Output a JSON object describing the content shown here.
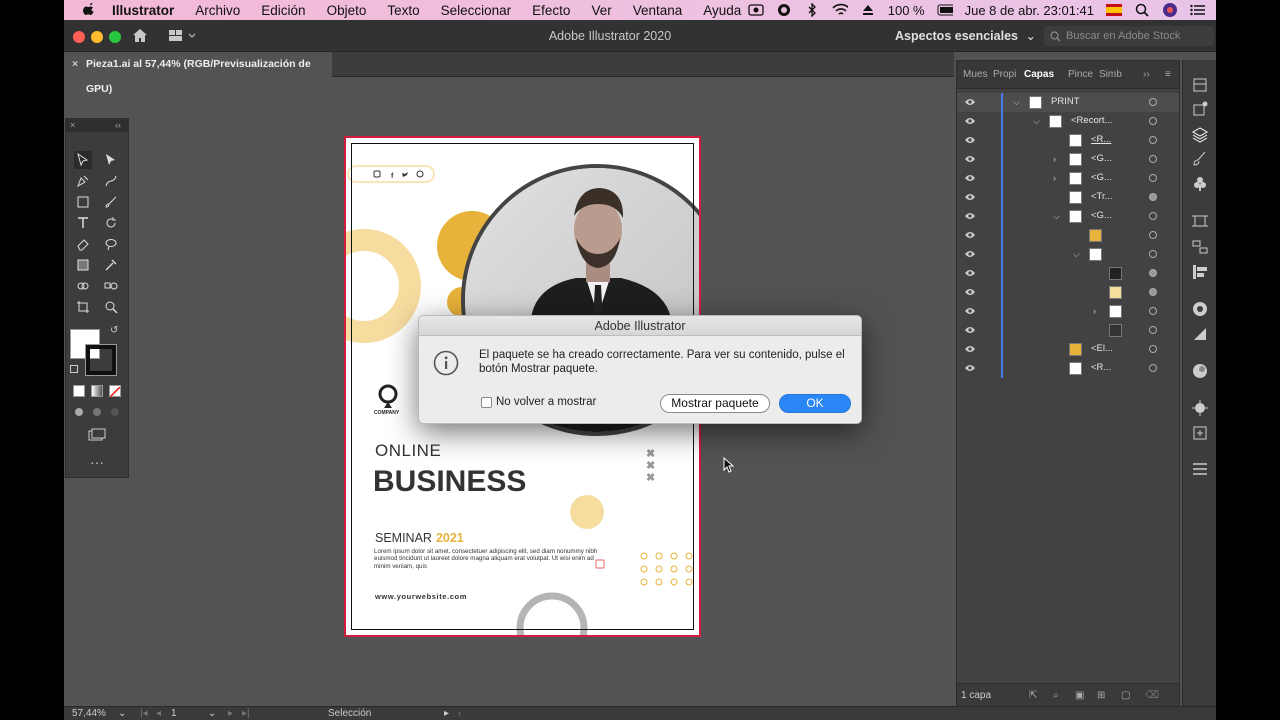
{
  "menubar": {
    "app_name": "Illustrator",
    "items": [
      "Archivo",
      "Edición",
      "Objeto",
      "Texto",
      "Seleccionar",
      "Efecto",
      "Ver",
      "Ventana",
      "Ayuda"
    ],
    "battery": "100 %",
    "datetime": "Jue 8 de abr.  23:01:41"
  },
  "titlebar": {
    "title": "Adobe Illustrator 2020",
    "workspace": "Aspectos esenciales",
    "search_placeholder": "Buscar en Adobe Stock"
  },
  "document": {
    "tab_label": "Pieza1.ai al 57,44% (RGB/Previsualización de GPU)"
  },
  "artwork": {
    "company": "COMPANY",
    "line1": "ONLINE",
    "line2": "BUSINESS",
    "seminar": "SEMINAR",
    "year": "2021",
    "body": "Lorem ipsum dolor sit amet, consectetuer adipiscing elit, sed diam nonummy nibh euismod tincidunt ut laoreet dolore magna aliquam erat volutpat. Ut wisi enim ad minim veniam, quis",
    "website": "www.yourwebsite.com",
    "colors": {
      "accent": "#e8b33b",
      "pale": "#f7dca0",
      "dark": "#333333"
    }
  },
  "dialog": {
    "title": "Adobe Illustrator",
    "message": "El paquete se ha creado correctamente. Para ver su contenido, pulse el botón Mostrar paquete.",
    "checkbox_label": "No volver a mostrar",
    "show_button": "Mostrar paquete",
    "ok_button": "OK"
  },
  "layers_panel": {
    "tabs": [
      "Mues",
      "Propi",
      "Capas",
      "Pince",
      "Simb"
    ],
    "active_tab": "Capas",
    "rows": [
      {
        "name": "PRINT"
      },
      {
        "name": "<Recort..."
      },
      {
        "name": "<R..."
      },
      {
        "name": "<G..."
      },
      {
        "name": "<G..."
      },
      {
        "name": "<Tr..."
      },
      {
        "name": "<G..."
      },
      {
        "name": ""
      },
      {
        "name": ""
      },
      {
        "name": ""
      },
      {
        "name": ""
      },
      {
        "name": ""
      },
      {
        "name": ""
      },
      {
        "name": "<El..."
      },
      {
        "name": "<R..."
      }
    ],
    "footer": "1 capa"
  },
  "statusbar": {
    "zoom": "57,44%",
    "artboard": "1",
    "tool": "Selección"
  }
}
